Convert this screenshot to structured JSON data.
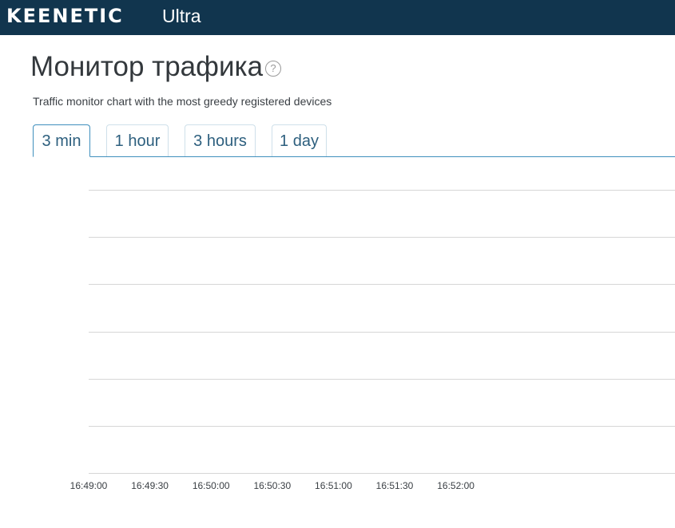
{
  "header": {
    "brand": "KEENETIC",
    "model": "Ultra",
    "background": "#11354e"
  },
  "page": {
    "title": "Монитор трафика",
    "help_icon": "question-circle-icon",
    "help_glyph": "?",
    "subtitle": "Traffic monitor chart with the most greedy registered devices"
  },
  "tabs": [
    {
      "label": "3 min",
      "active": true
    },
    {
      "label": "1 hour",
      "active": false
    },
    {
      "label": "3 hours",
      "active": false
    },
    {
      "label": "1 day",
      "active": false
    }
  ],
  "chart_data": {
    "type": "line",
    "title": "",
    "xlabel": "",
    "ylabel": "",
    "x_ticks": [
      "16:49:00",
      "16:49:30",
      "16:50:00",
      "16:50:30",
      "16:51:00",
      "16:51:30",
      "16:52:00"
    ],
    "gridline_count": 7,
    "series": [],
    "grid": true,
    "legend": "none",
    "grid_color": "#d6d6d6",
    "accent": "#3f8fbd"
  }
}
